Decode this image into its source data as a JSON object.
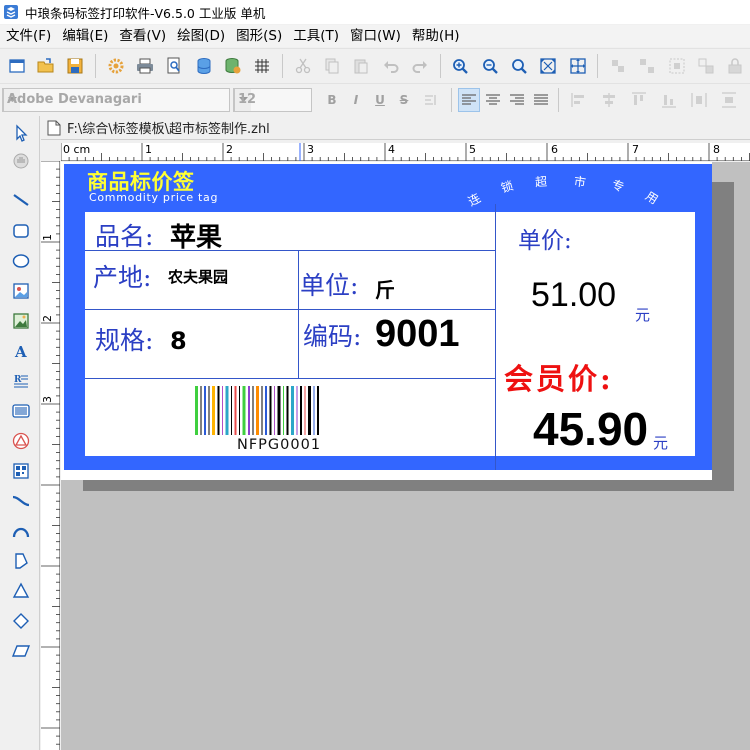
{
  "window": {
    "title": "中琅条码标签打印软件-V6.5.0 工业版 单机"
  },
  "menu": [
    {
      "label": "文件(F)"
    },
    {
      "label": "编辑(E)"
    },
    {
      "label": "查看(V)"
    },
    {
      "label": "绘图(D)"
    },
    {
      "label": "图形(S)"
    },
    {
      "label": "工具(T)"
    },
    {
      "label": "窗口(W)"
    },
    {
      "label": "帮助(H)"
    }
  ],
  "format_toolbar": {
    "font_name": "Adobe Devanagari",
    "font_size": "12",
    "bold": "B",
    "italic": "I",
    "underline": "U",
    "strike": "S"
  },
  "document": {
    "path": "F:\\综合\\标签模板\\超市标签制作.zhl"
  },
  "ruler": {
    "h_ticks": [
      "0 cm",
      "1",
      "2",
      "3",
      "4",
      "5",
      "6",
      "7",
      "8"
    ],
    "v_ticks": [
      "1",
      "2",
      "3"
    ]
  },
  "label": {
    "header_title": "商品标价签",
    "header_subtitle": "Commodity price tag",
    "arc_text": [
      "连",
      "锁",
      "超",
      "市",
      "专",
      "用"
    ],
    "name_label": "品名:",
    "name_value": "苹果",
    "origin_label": "产地:",
    "origin_value": "农夫果园",
    "unit_label": "单位:",
    "unit_value": "斤",
    "spec_label": "规格:",
    "spec_value": "8",
    "code_label": "编码:",
    "code_value": "9001",
    "barcode_text": "NFPG0001",
    "price_label": "单价:",
    "price_value": "51.00",
    "price_currency": "元",
    "member_label": "会员价:",
    "member_value": "45.90",
    "member_currency": "元"
  },
  "colors": {
    "label_blue": "#3366ff",
    "header_yellow": "#ffff33",
    "text_blue": "#2b3fc4",
    "member_red": "#ee1111"
  }
}
